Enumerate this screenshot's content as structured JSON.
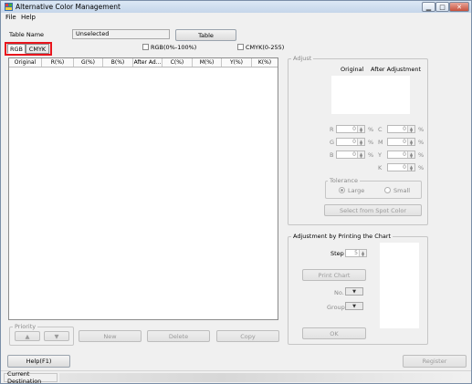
{
  "window": {
    "title": "Alternative Color Management"
  },
  "menu": {
    "file": "File",
    "help": "Help"
  },
  "table_row": {
    "label": "Table Name",
    "value": "Unselected",
    "button": "Table"
  },
  "tabs": [
    "RGB",
    "CMYK"
  ],
  "checks": {
    "rgb_range": "RGB(0%-100%)",
    "cmyk_range": "CMYK(0-255)"
  },
  "grid": {
    "columns": [
      "Original",
      "R(%)",
      "G(%)",
      "B(%)",
      "After Ad...",
      "C(%)",
      "M(%)",
      "Y(%)",
      "K(%)"
    ]
  },
  "priority": {
    "title": "Priority",
    "up": "▲",
    "down": "▼"
  },
  "grid_buttons": {
    "new": "New",
    "delete": "Delete",
    "copy": "Copy"
  },
  "adjust": {
    "title": "Adjust",
    "original": "Original",
    "after": "After Adjustment",
    "r": "R",
    "g": "G",
    "b": "B",
    "c": "C",
    "m": "M",
    "y": "Y",
    "k": "K",
    "zero": "0",
    "pct": "%",
    "tolerance_title": "Tolerance",
    "large": "Large",
    "small": "Small",
    "spot_button": "Select from Spot Color"
  },
  "chart": {
    "title": "Adjustment by Printing the Chart",
    "step_label": "Step",
    "step_value": "5",
    "print_button": "Print Chart",
    "no_label": "No.",
    "group_label": "Group",
    "ok_button": "OK"
  },
  "bottom": {
    "help_button": "Help(F1)",
    "register_button": "Register"
  },
  "status": {
    "destination": "Current Destination"
  }
}
